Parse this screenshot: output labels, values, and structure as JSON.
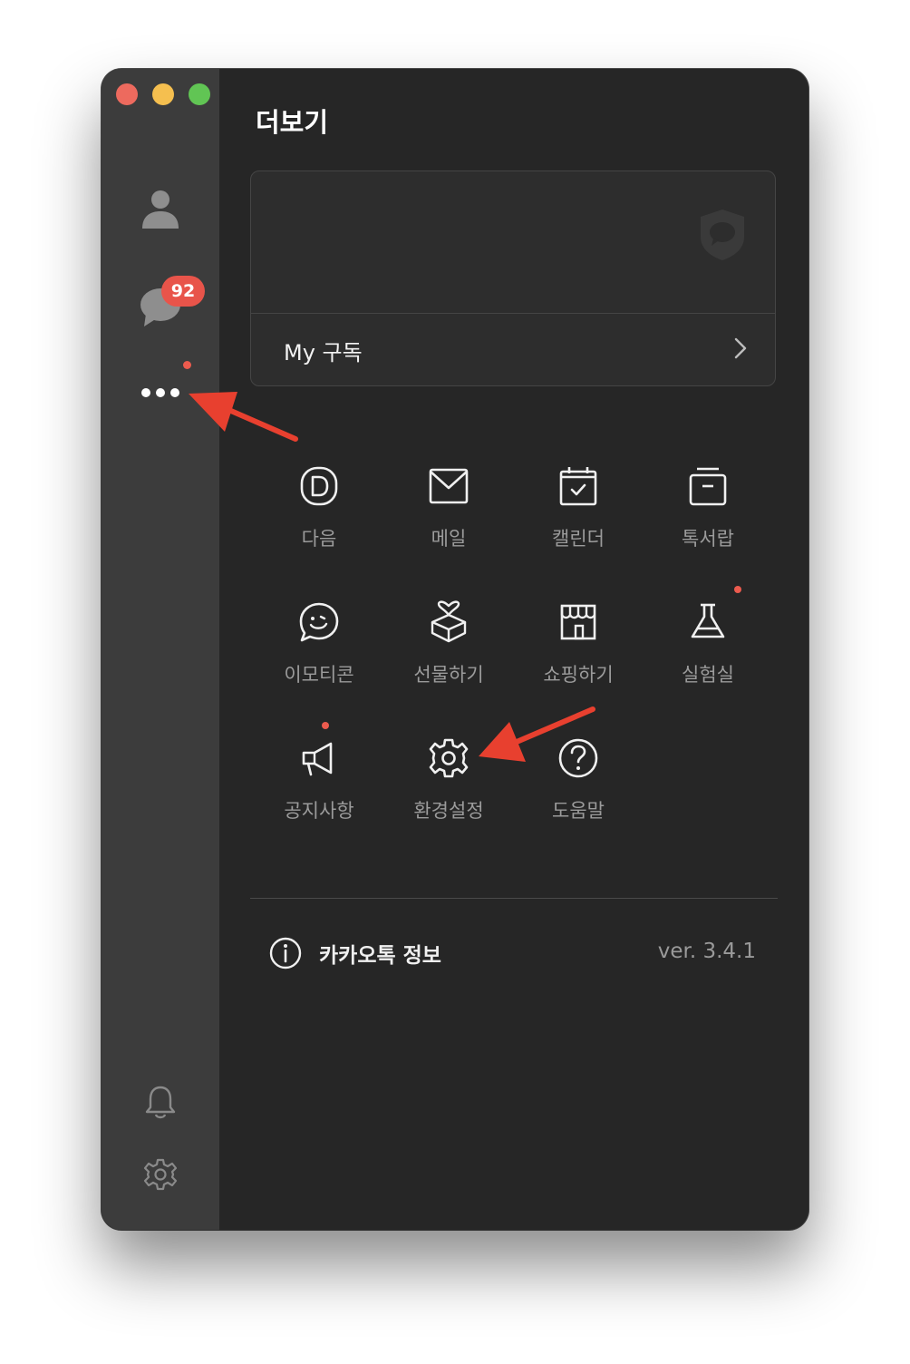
{
  "window": {
    "traffic_lights": [
      "close",
      "minimize",
      "zoom"
    ]
  },
  "sidebar": {
    "items": [
      {
        "name": "friends",
        "icon": "person-icon"
      },
      {
        "name": "chats",
        "icon": "chat-bubble-icon",
        "badge": "92"
      },
      {
        "name": "more",
        "icon": "more-dots-icon",
        "has_new_dot": true
      }
    ],
    "bottom_items": [
      {
        "name": "notifications",
        "icon": "bell-icon"
      },
      {
        "name": "settings",
        "icon": "gear-icon"
      }
    ]
  },
  "header": {
    "title": "더보기"
  },
  "subscription": {
    "label": "My 구독"
  },
  "grid": [
    {
      "label": "다음",
      "icon": "daum-icon"
    },
    {
      "label": "메일",
      "icon": "mail-icon"
    },
    {
      "label": "캘린더",
      "icon": "calendar-icon"
    },
    {
      "label": "톡서랍",
      "icon": "drawer-icon"
    },
    {
      "label": "이모티콘",
      "icon": "emoticon-icon"
    },
    {
      "label": "선물하기",
      "icon": "gift-icon"
    },
    {
      "label": "쇼핑하기",
      "icon": "store-icon"
    },
    {
      "label": "실험실",
      "icon": "flask-icon",
      "has_new_dot": true
    },
    {
      "label": "공지사항",
      "icon": "megaphone-icon",
      "has_new_dot": true
    },
    {
      "label": "환경설정",
      "icon": "settings-gear-icon"
    },
    {
      "label": "도움말",
      "icon": "help-icon"
    }
  ],
  "footer": {
    "info_label": "카카오톡 정보",
    "version": "ver. 3.4.1"
  },
  "colors": {
    "sidebar_bg": "#3c3c3c",
    "main_bg": "#262626",
    "badge": "#e8544a",
    "annotation_arrow": "#e8402f"
  }
}
